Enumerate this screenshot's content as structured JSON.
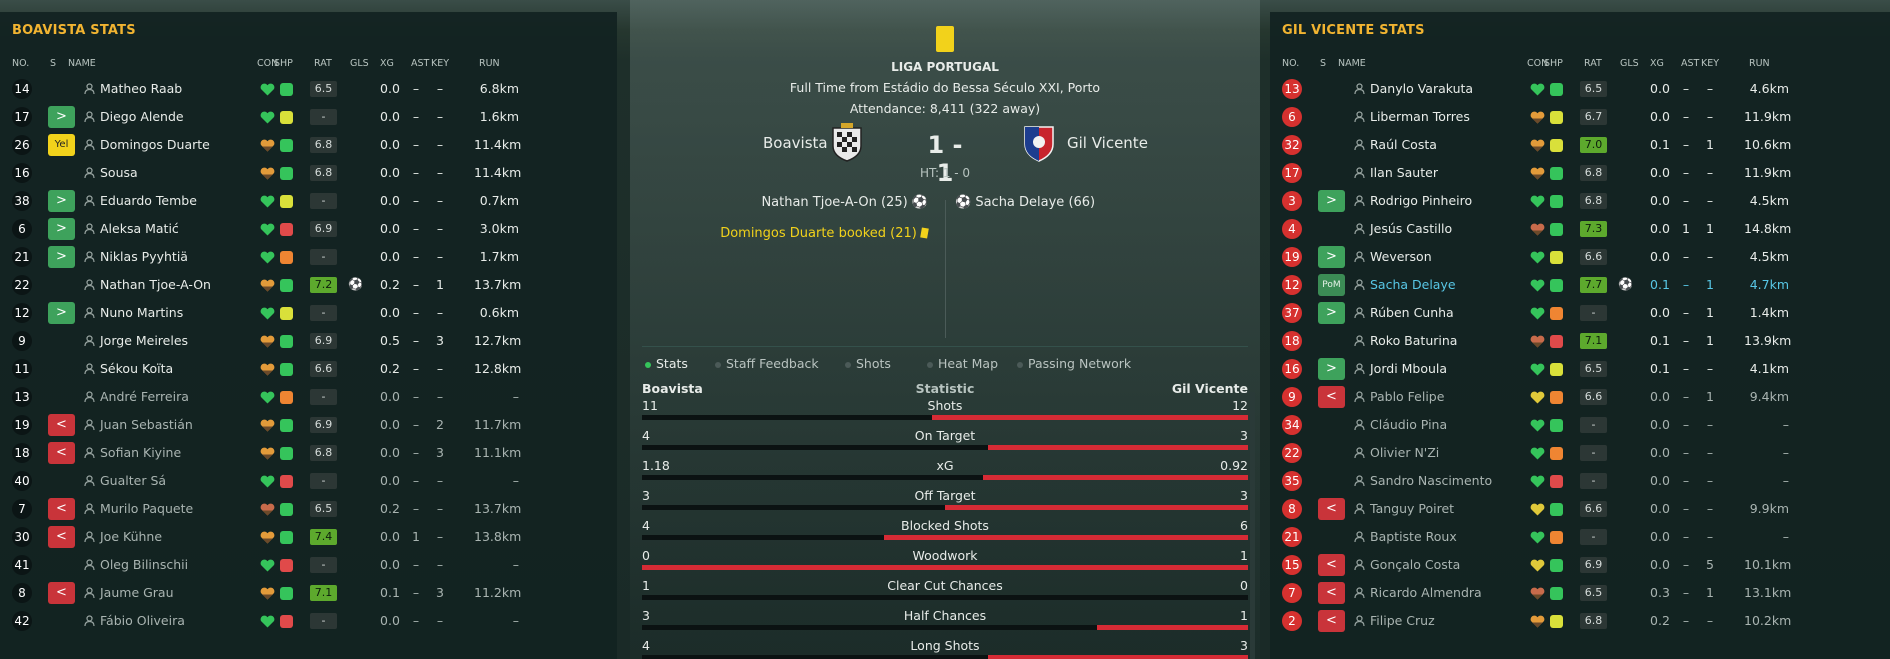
{
  "left_panel": {
    "title": "BOAVISTA STATS",
    "headers": [
      "NO.",
      "S",
      "NAME",
      "CON",
      "SHP",
      "RAT",
      "GLS",
      "XG",
      "AST",
      "KEY",
      "RUN"
    ],
    "players": [
      {
        "no": "14",
        "sub": "",
        "name": "Matheo Raab",
        "con": "g",
        "shp": "g",
        "rat": "6.5",
        "gls": "",
        "xg": "0.0",
        "ast": "–",
        "key": "–",
        "run": "6.8km"
      },
      {
        "no": "17",
        "sub": ">",
        "name": "Diego Alende",
        "con": "g",
        "shp": "y",
        "rat": "-",
        "gls": "",
        "xg": "0.0",
        "ast": "–",
        "key": "–",
        "run": "1.6km"
      },
      {
        "no": "26",
        "sub": "Yel",
        "name": "Domingos Duarte",
        "con": "o",
        "shp": "g",
        "rat": "6.8",
        "gls": "",
        "xg": "0.0",
        "ast": "–",
        "key": "–",
        "run": "11.4km"
      },
      {
        "no": "16",
        "sub": "",
        "name": "Sousa",
        "con": "o",
        "shp": "g",
        "rat": "6.8",
        "gls": "",
        "xg": "0.0",
        "ast": "–",
        "key": "–",
        "run": "11.4km"
      },
      {
        "no": "38",
        "sub": ">",
        "name": "Eduardo Tembe",
        "con": "g",
        "shp": "y",
        "rat": "-",
        "gls": "",
        "xg": "0.0",
        "ast": "–",
        "key": "–",
        "run": "0.7km"
      },
      {
        "no": "6",
        "sub": ">",
        "name": "Aleksa Matić",
        "con": "g",
        "shp": "r",
        "rat": "6.9",
        "gls": "",
        "xg": "0.0",
        "ast": "–",
        "key": "–",
        "run": "3.0km"
      },
      {
        "no": "21",
        "sub": ">",
        "name": "Niklas Pyyhtiä",
        "con": "g",
        "shp": "o",
        "rat": "-",
        "gls": "",
        "xg": "0.0",
        "ast": "–",
        "key": "–",
        "run": "1.7km"
      },
      {
        "no": "22",
        "sub": "",
        "name": "Nathan Tjoe-A-On",
        "con": "o",
        "shp": "g",
        "rat": "7.2",
        "best": true,
        "gls": "⚽",
        "xg": "0.2",
        "ast": "–",
        "key": "1",
        "run": "13.7km"
      },
      {
        "no": "12",
        "sub": ">",
        "name": "Nuno Martins",
        "con": "g",
        "shp": "y",
        "rat": "-",
        "gls": "",
        "xg": "0.0",
        "ast": "–",
        "key": "–",
        "run": "0.6km"
      },
      {
        "no": "9",
        "sub": "",
        "name": "Jorge Meireles",
        "con": "o",
        "shp": "g",
        "rat": "6.9",
        "gls": "",
        "xg": "0.5",
        "ast": "–",
        "key": "3",
        "run": "12.7km"
      },
      {
        "no": "11",
        "sub": "",
        "name": "Sékou Koïta",
        "con": "o",
        "shp": "g",
        "rat": "6.6",
        "gls": "",
        "xg": "0.2",
        "ast": "–",
        "key": "–",
        "run": "12.8km"
      },
      {
        "no": "13",
        "sub": "",
        "name": "André Ferreira",
        "con": "g",
        "shp": "o",
        "rat": "-",
        "gls": "",
        "xg": "0.0",
        "ast": "–",
        "key": "–",
        "run": "–",
        "dim": true
      },
      {
        "no": "19",
        "sub": "<",
        "name": "Juan Sebastián",
        "con": "o",
        "shp": "g",
        "rat": "6.9",
        "gls": "",
        "xg": "0.0",
        "ast": "–",
        "key": "2",
        "run": "11.7km",
        "dim": true
      },
      {
        "no": "18",
        "sub": "<",
        "name": "Sofian Kiyine",
        "con": "o",
        "shp": "g",
        "rat": "6.8",
        "gls": "",
        "xg": "0.0",
        "ast": "–",
        "key": "3",
        "run": "11.1km",
        "dim": true
      },
      {
        "no": "40",
        "sub": "",
        "name": "Gualter Sá",
        "con": "g",
        "shp": "r",
        "rat": "-",
        "gls": "",
        "xg": "0.0",
        "ast": "–",
        "key": "–",
        "run": "–",
        "dim": true
      },
      {
        "no": "7",
        "sub": "<",
        "name": "Murilo Paquete",
        "con": "b",
        "shp": "g",
        "rat": "6.5",
        "gls": "",
        "xg": "0.2",
        "ast": "–",
        "key": "–",
        "run": "13.7km",
        "dim": true
      },
      {
        "no": "30",
        "sub": "<",
        "name": "Joe Kühne",
        "con": "o",
        "shp": "g",
        "rat": "7.4",
        "best": true,
        "gls": "",
        "xg": "0.0",
        "ast": "1",
        "key": "–",
        "run": "13.8km",
        "dim": true
      },
      {
        "no": "41",
        "sub": "",
        "name": "Oleg Bilinschii",
        "con": "g",
        "shp": "r",
        "rat": "-",
        "gls": "",
        "xg": "0.0",
        "ast": "–",
        "key": "–",
        "run": "–",
        "dim": true
      },
      {
        "no": "8",
        "sub": "<",
        "name": "Jaume Grau",
        "con": "o",
        "shp": "g",
        "rat": "7.1",
        "best": true,
        "gls": "",
        "xg": "0.1",
        "ast": "–",
        "key": "3",
        "run": "11.2km",
        "dim": true
      },
      {
        "no": "42",
        "sub": "",
        "name": "Fábio Oliveira",
        "con": "g",
        "shp": "r",
        "rat": "-",
        "gls": "",
        "xg": "0.0",
        "ast": "–",
        "key": "–",
        "run": "–",
        "dim": true
      }
    ]
  },
  "right_panel": {
    "title": "GIL VICENTE STATS",
    "headers": [
      "NO.",
      "S",
      "NAME",
      "CON",
      "SHP",
      "RAT",
      "GLS",
      "XG",
      "AST",
      "KEY",
      "RUN"
    ],
    "players": [
      {
        "no": "13",
        "sub": "",
        "name": "Danylo Varakuta",
        "con": "g",
        "shp": "g",
        "rat": "6.5",
        "gls": "",
        "xg": "0.0",
        "ast": "–",
        "key": "–",
        "run": "4.6km"
      },
      {
        "no": "6",
        "sub": "",
        "name": "Liberman Torres",
        "con": "o",
        "shp": "y",
        "rat": "6.7",
        "gls": "",
        "xg": "0.0",
        "ast": "–",
        "key": "–",
        "run": "11.9km"
      },
      {
        "no": "32",
        "sub": "",
        "name": "Raúl Costa",
        "con": "o",
        "shp": "y",
        "rat": "7.0",
        "best": true,
        "gls": "",
        "xg": "0.1",
        "ast": "–",
        "key": "1",
        "run": "10.6km"
      },
      {
        "no": "17",
        "sub": "",
        "name": "Ilan Sauter",
        "con": "o",
        "shp": "g",
        "rat": "6.8",
        "gls": "",
        "xg": "0.0",
        "ast": "–",
        "key": "–",
        "run": "11.9km"
      },
      {
        "no": "3",
        "sub": ">",
        "name": "Rodrigo Pinheiro",
        "con": "g",
        "shp": "g",
        "rat": "6.8",
        "gls": "",
        "xg": "0.0",
        "ast": "–",
        "key": "–",
        "run": "4.5km"
      },
      {
        "no": "4",
        "sub": "",
        "name": "Jesús Castillo",
        "con": "b",
        "shp": "g",
        "rat": "7.3",
        "best": true,
        "gls": "",
        "xg": "0.0",
        "ast": "1",
        "key": "1",
        "run": "14.8km"
      },
      {
        "no": "19",
        "sub": ">",
        "name": "Weverson",
        "con": "g",
        "shp": "y",
        "rat": "6.6",
        "gls": "",
        "xg": "0.0",
        "ast": "–",
        "key": "–",
        "run": "4.5km"
      },
      {
        "no": "12",
        "sub": "PoM",
        "name": "Sacha Delaye",
        "con": "g",
        "shp": "g",
        "rat": "7.7",
        "best": true,
        "gls": "⚽",
        "xg": "0.1",
        "ast": "–",
        "key": "1",
        "run": "4.7km",
        "hl": true
      },
      {
        "no": "37",
        "sub": ">",
        "name": "Rúben Cunha",
        "con": "g",
        "shp": "o",
        "rat": "-",
        "gls": "",
        "xg": "0.0",
        "ast": "–",
        "key": "1",
        "run": "1.4km"
      },
      {
        "no": "18",
        "sub": "",
        "name": "Roko Baturina",
        "con": "b",
        "shp": "r",
        "rat": "7.1",
        "best": true,
        "gls": "",
        "xg": "0.1",
        "ast": "–",
        "key": "1",
        "run": "13.9km"
      },
      {
        "no": "16",
        "sub": ">",
        "name": "Jordi Mboula",
        "con": "g",
        "shp": "y",
        "rat": "6.5",
        "gls": "",
        "xg": "0.1",
        "ast": "–",
        "key": "–",
        "run": "4.1km"
      },
      {
        "no": "9",
        "sub": "<",
        "name": "Pablo Felipe",
        "con": "y",
        "shp": "o",
        "rat": "6.6",
        "gls": "",
        "xg": "0.0",
        "ast": "–",
        "key": "1",
        "run": "9.4km",
        "dim": true
      },
      {
        "no": "34",
        "sub": "",
        "name": "Cláudio Pina",
        "con": "g",
        "shp": "g",
        "rat": "-",
        "gls": "",
        "xg": "0.0",
        "ast": "–",
        "key": "–",
        "run": "–",
        "dim": true
      },
      {
        "no": "22",
        "sub": "",
        "name": "Olivier N'Zi",
        "con": "g",
        "shp": "o",
        "rat": "-",
        "gls": "",
        "xg": "0.0",
        "ast": "–",
        "key": "–",
        "run": "–",
        "dim": true
      },
      {
        "no": "35",
        "sub": "",
        "name": "Sandro Nascimento",
        "con": "g",
        "shp": "r",
        "rat": "-",
        "gls": "",
        "xg": "0.0",
        "ast": "–",
        "key": "–",
        "run": "–",
        "dim": true
      },
      {
        "no": "8",
        "sub": "<",
        "name": "Tanguy Poiret",
        "con": "y",
        "shp": "g",
        "rat": "6.6",
        "gls": "",
        "xg": "0.0",
        "ast": "–",
        "key": "–",
        "run": "9.9km",
        "dim": true
      },
      {
        "no": "21",
        "sub": "",
        "name": "Baptiste Roux",
        "con": "g",
        "shp": "o",
        "rat": "-",
        "gls": "",
        "xg": "0.0",
        "ast": "–",
        "key": "–",
        "run": "–",
        "dim": true
      },
      {
        "no": "15",
        "sub": "<",
        "name": "Gonçalo Costa",
        "con": "y",
        "shp": "g",
        "rat": "6.9",
        "gls": "",
        "xg": "0.0",
        "ast": "–",
        "key": "5",
        "run": "10.1km",
        "dim": true
      },
      {
        "no": "7",
        "sub": "<",
        "name": "Ricardo Almendra",
        "con": "b",
        "shp": "g",
        "rat": "6.5",
        "gls": "",
        "xg": "0.3",
        "ast": "–",
        "key": "1",
        "run": "13.1km",
        "dim": true
      },
      {
        "no": "2",
        "sub": "<",
        "name": "Filipe Cruz",
        "con": "o",
        "shp": "y",
        "rat": "6.8",
        "gls": "",
        "xg": "0.2",
        "ast": "–",
        "key": "–",
        "run": "10.2km",
        "dim": true
      }
    ]
  },
  "match": {
    "competition": "LIGA PORTUGAL",
    "full_time": "Full Time from Estádio do Bessa Século XXI, Porto",
    "attendance": "Attendance: 8,411 (322 away)",
    "home": "Boavista",
    "away": "Gil Vicente",
    "score": "1 - 1",
    "ht": "HT: 1 - 0",
    "home_goal": "Nathan Tjoe-A-On (25)",
    "away_goal": "Sacha Delaye (66)",
    "booking": "Domingos Duarte booked (21)"
  },
  "tabs": [
    "Stats",
    "Staff Feedback",
    "Shots",
    "Heat Map",
    "Passing Network"
  ],
  "stats_header": {
    "home": "Boavista",
    "mid": "Statistic",
    "away": "Gil Vicente"
  },
  "stats": [
    {
      "label": "Shots",
      "home": "11",
      "away": "12",
      "h": 11,
      "a": 12
    },
    {
      "label": "On Target",
      "home": "4",
      "away": "3",
      "h": 4,
      "a": 3
    },
    {
      "label": "xG",
      "home": "1.18",
      "away": "0.92",
      "h": 1.18,
      "a": 0.92
    },
    {
      "label": "Off Target",
      "home": "3",
      "away": "3",
      "h": 3,
      "a": 3
    },
    {
      "label": "Blocked Shots",
      "home": "4",
      "away": "6",
      "h": 4,
      "a": 6
    },
    {
      "label": "Woodwork",
      "home": "0",
      "away": "1",
      "h": 0,
      "a": 1
    },
    {
      "label": "Clear Cut Chances",
      "home": "1",
      "away": "0",
      "h": 1,
      "a": 0
    },
    {
      "label": "Half Chances",
      "home": "3",
      "away": "1",
      "h": 3,
      "a": 1
    },
    {
      "label": "Long Shots",
      "home": "4",
      "away": "3",
      "h": 4,
      "a": 3
    }
  ],
  "colors": {
    "accent": "#f2b431",
    "away_bar": "#d62b35",
    "best_rating": "#5da92d",
    "sub_in": "#3ea25c",
    "sub_out": "#c9343a"
  }
}
